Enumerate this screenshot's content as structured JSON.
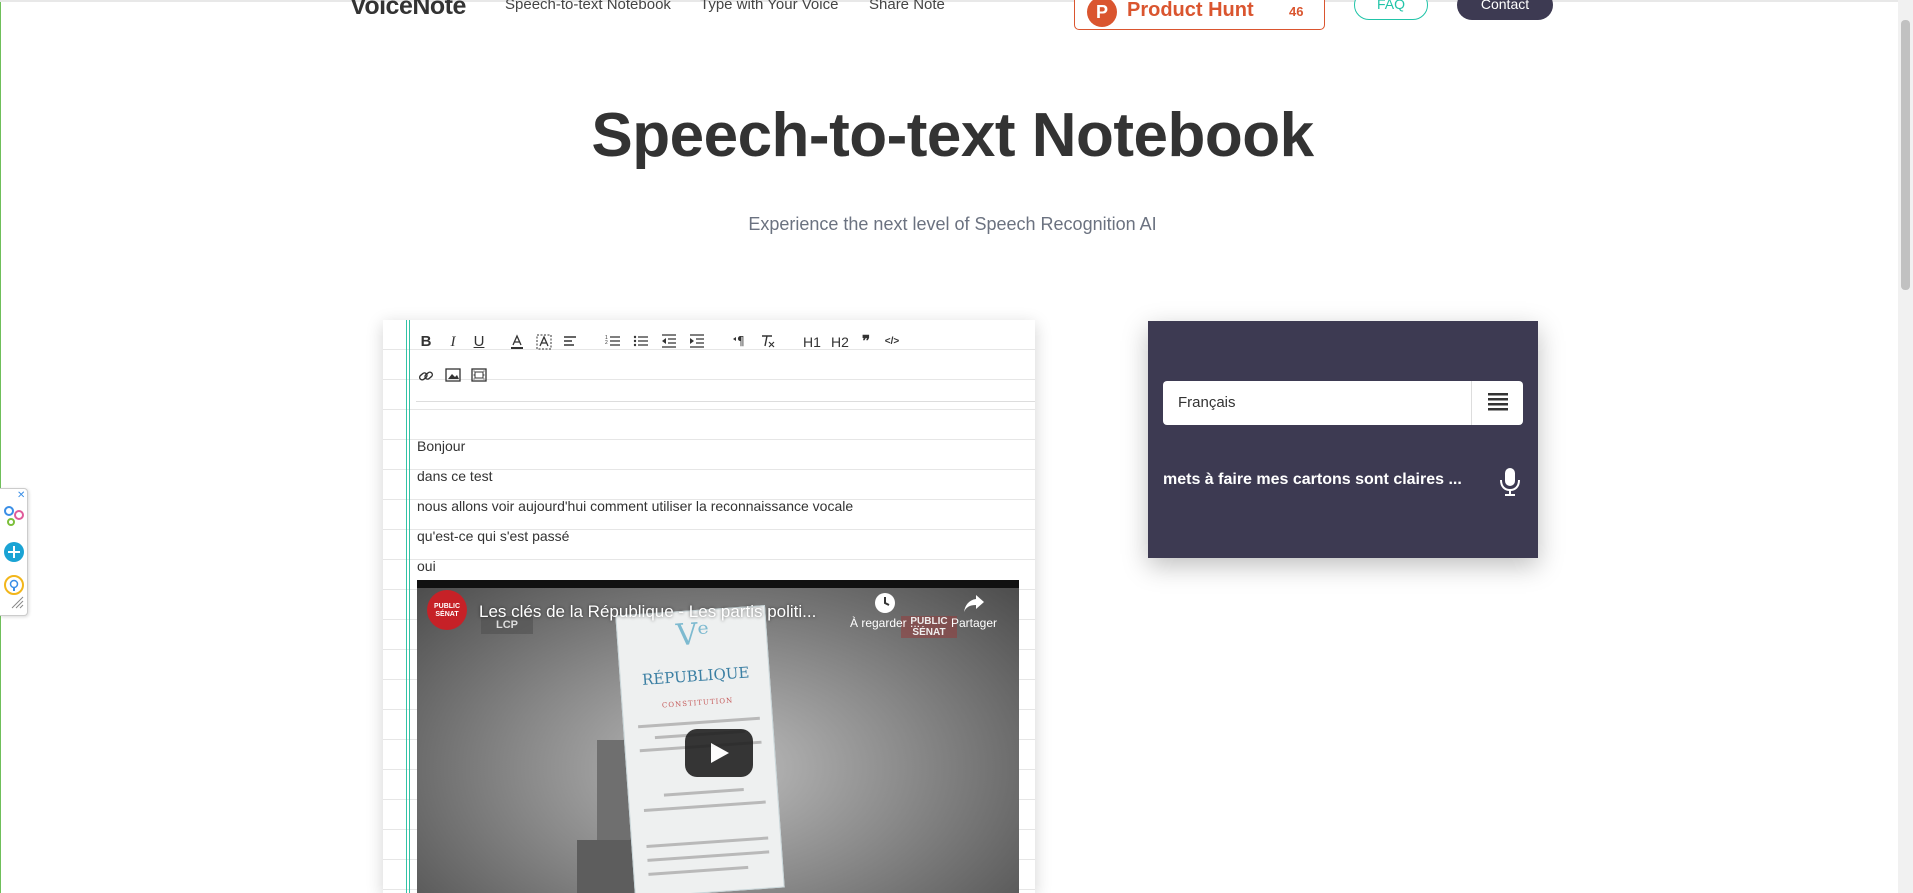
{
  "nav": {
    "brand": "VoiceNote",
    "links": [
      "Speech-to-text Notebook",
      "Type with Your Voice",
      "Share Note"
    ],
    "product_hunt": {
      "label": "Product Hunt",
      "count": "46"
    },
    "faq": "FAQ",
    "contact": "Contact"
  },
  "hero": {
    "title": "Speech-to-text Notebook",
    "subtitle": "Experience the next level of Speech Recognition AI"
  },
  "toolbar": {
    "bold": "B",
    "italic": "I",
    "underline": "U",
    "h1": "H1",
    "h2": "H2",
    "quote": "❞",
    "code": "</>"
  },
  "editor": {
    "lines": [
      "Bonjour",
      "dans ce test",
      "nous allons voir aujourd'hui comment utiliser la reconnaissance vocale",
      "qu'est-ce qui s'est passé",
      "oui"
    ]
  },
  "video": {
    "channel_logo": "PUBLIC SÉNAT",
    "title": "Les clés de la République - Les partis politi...",
    "watch_later": "À regarder ...",
    "share": "Partager",
    "lcp": "LCP",
    "ps_tag": "PUBLIC SÉNAT",
    "doc_v": "Vᵉ",
    "doc_republique": "RÉPUBLIQUE",
    "doc_constitution": "CONSTITUTION"
  },
  "panel": {
    "language": "Français",
    "transcript": "mets à faire mes cartons sont claires ..."
  },
  "colors": {
    "accent": "#21c4a8",
    "panel_bg": "#3d3a52",
    "product_hunt": "#da552f"
  }
}
